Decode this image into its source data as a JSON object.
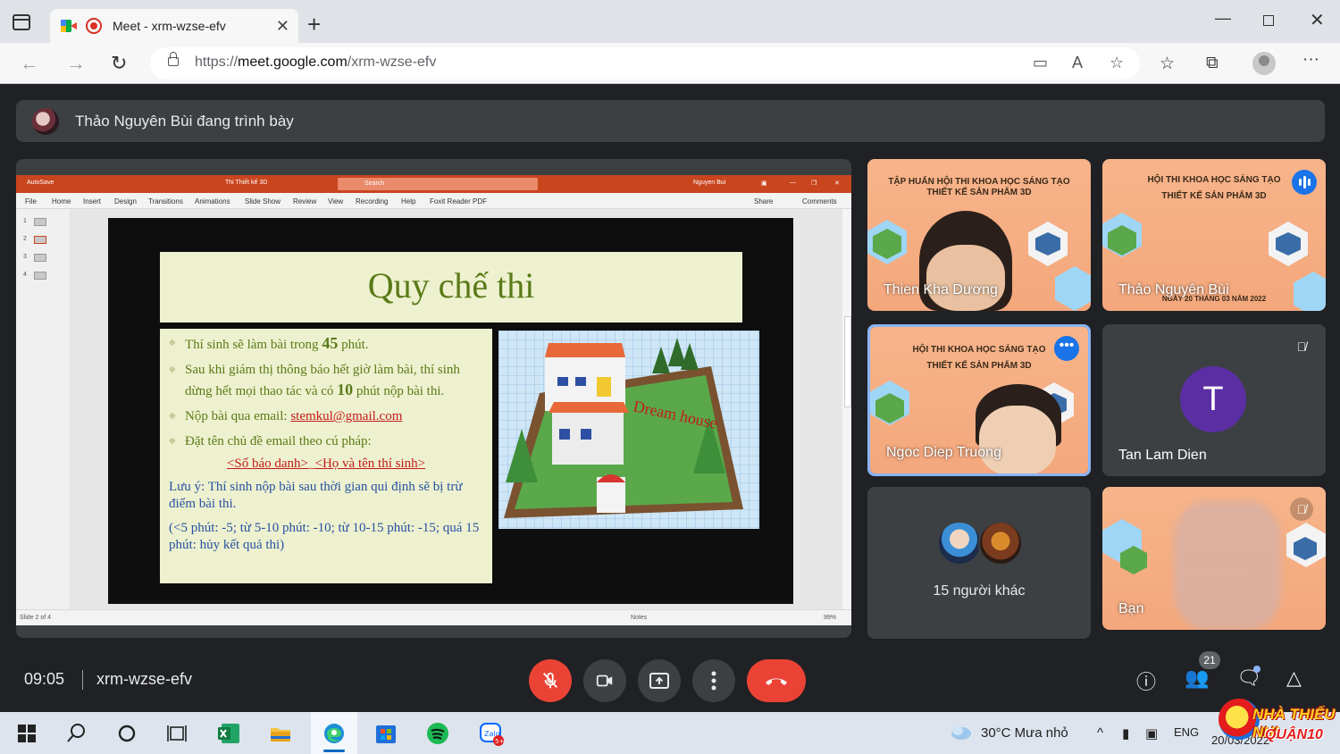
{
  "browser": {
    "tab_title": "Meet - xrm-wzse-efv",
    "url_scheme": "https://",
    "url_host": "meet.google.com",
    "url_path": "/xrm-wzse-efv",
    "icons": [
      "tab-actions-icon",
      "meet-favicon",
      "record-icon",
      "close-icon",
      "new-tab-icon",
      "minimize-icon",
      "maximize-icon",
      "close-window-icon",
      "back-icon",
      "forward-icon",
      "reload-icon",
      "lock-icon",
      "camera-icon",
      "read-aloud-icon",
      "add-favorite-icon",
      "favorites-icon",
      "collections-icon",
      "profile-icon",
      "more-icon"
    ]
  },
  "meet": {
    "presenter_text": "Thảo Nguyên Bùi đang trình bày",
    "time": "09:05",
    "code": "xrm-wzse-efv",
    "participant_count": "21",
    "colors": {
      "bg": "#202124",
      "tile": "#3c4043",
      "red": "#ea4335",
      "blue": "#1a73e8",
      "purple": "#5b2fa3"
    }
  },
  "ppt": {
    "autosave": "AutoSave",
    "doc_name": "Thi Thiết kế 3D",
    "search": "Search",
    "user": "Nguyen Bui",
    "ribbon": [
      "File",
      "Home",
      "Insert",
      "Design",
      "Transitions",
      "Animations",
      "Slide Show",
      "Review",
      "View",
      "Recording",
      "Help",
      "Foxit Reader PDF"
    ],
    "share": "Share",
    "comments": "Comments",
    "thumbs": [
      "1",
      "2",
      "3",
      "4"
    ],
    "status_left": "Slide 2 of 4",
    "status_notes": "Notes",
    "zoom": "99%"
  },
  "slide": {
    "title": "Quy chế thi",
    "b1_pre": "Thí sinh sẽ làm bài trong ",
    "b1_num": "45",
    "b1_post": " phút.",
    "b2_pre": "Sau khi giám thị thông báo hết giờ làm bài, thí sinh dừng hết mọi thao tác và có ",
    "b2_num": "10",
    "b2_post": " phút nộp bài thi.",
    "b3_pre": "Nộp bài qua email: ",
    "b3_mail": "stemkul@gmail.com",
    "b4": "Đặt tên chủ đề email theo cú pháp:",
    "syntax_a": "<Số báo danh>",
    "syntax_sep": "_",
    "syntax_b": "<Họ và tên thí sinh>",
    "note1": "Lưu ý: Thí sinh nộp bài sau thời gian qui định sẽ bị trừ điểm bài thi.",
    "note2": "(<5 phút: -5; từ 5-10 phút: -10; từ 10-15 phút: -15; quá 15 phút: hủy kết quả thi)",
    "image_label": "Dream house"
  },
  "participants": {
    "p1": {
      "name": "Thien Kha Dương",
      "banner1": "TẬP HUẤN HỘI THI KHOA HỌC SÁNG TẠO",
      "banner2": "THIẾT KẾ SẢN PHẨM 3D"
    },
    "p2": {
      "name": "Thảo Nguyên Bùi",
      "banner1": "HỘI THI KHOA HỌC SÁNG TẠO",
      "banner2": "THIẾT KẾ SẢN PHẨM 3D",
      "banner3": "NGÀY 20 THÁNG 03 NĂM 2022"
    },
    "p3": {
      "name": "Ngoc Diep Truong",
      "banner1": "HỘI THI KHOA HỌC SÁNG TẠO",
      "banner2": "THIẾT KẾ SẢN PHẨM 3D"
    },
    "p4": {
      "name": "Tan Lam Dien",
      "initial": "T"
    },
    "others": {
      "label": "15 người khác"
    },
    "self": {
      "name": "Bạn"
    }
  },
  "taskbar": {
    "weather": "30°C  Mưa nhỏ",
    "lang": "ENG",
    "date": "20/03/2022",
    "zalo_badge": "5+",
    "icons": [
      "windows-start-icon",
      "search-icon",
      "cortana-icon",
      "task-view-icon",
      "excel-icon",
      "file-explorer-icon",
      "edge-icon",
      "store-icon",
      "spotify-icon",
      "zalo-icon",
      "weather-icon",
      "chevron-up-icon",
      "microphone-icon",
      "display-icon",
      "speaker-icon"
    ]
  },
  "brand": {
    "line1": "NHÀ THIẾU NHI",
    "line2": "QUẬN10"
  }
}
